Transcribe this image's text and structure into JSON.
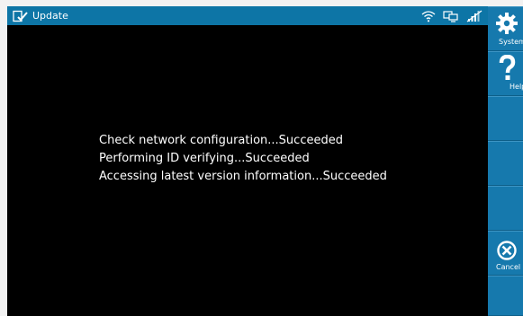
{
  "titlebar": {
    "title": "Update",
    "app_icon": "update-document-check-icon",
    "status_icons": [
      "wifi-icon",
      "network-monitor-icon",
      "signal-disabled-icon"
    ]
  },
  "log_lines": [
    "Check network configuration...Succeeded",
    "Performing ID verifying...Succeeded",
    "Accessing latest version information...Succeeded"
  ],
  "sidebar": {
    "system_label": "System",
    "help_label": "Help",
    "cancel_label": "Cancel"
  },
  "colors": {
    "titlebar": "#0d75a6",
    "sidebar": "#1679ad",
    "background": "#000000",
    "text": "#ffffff"
  }
}
